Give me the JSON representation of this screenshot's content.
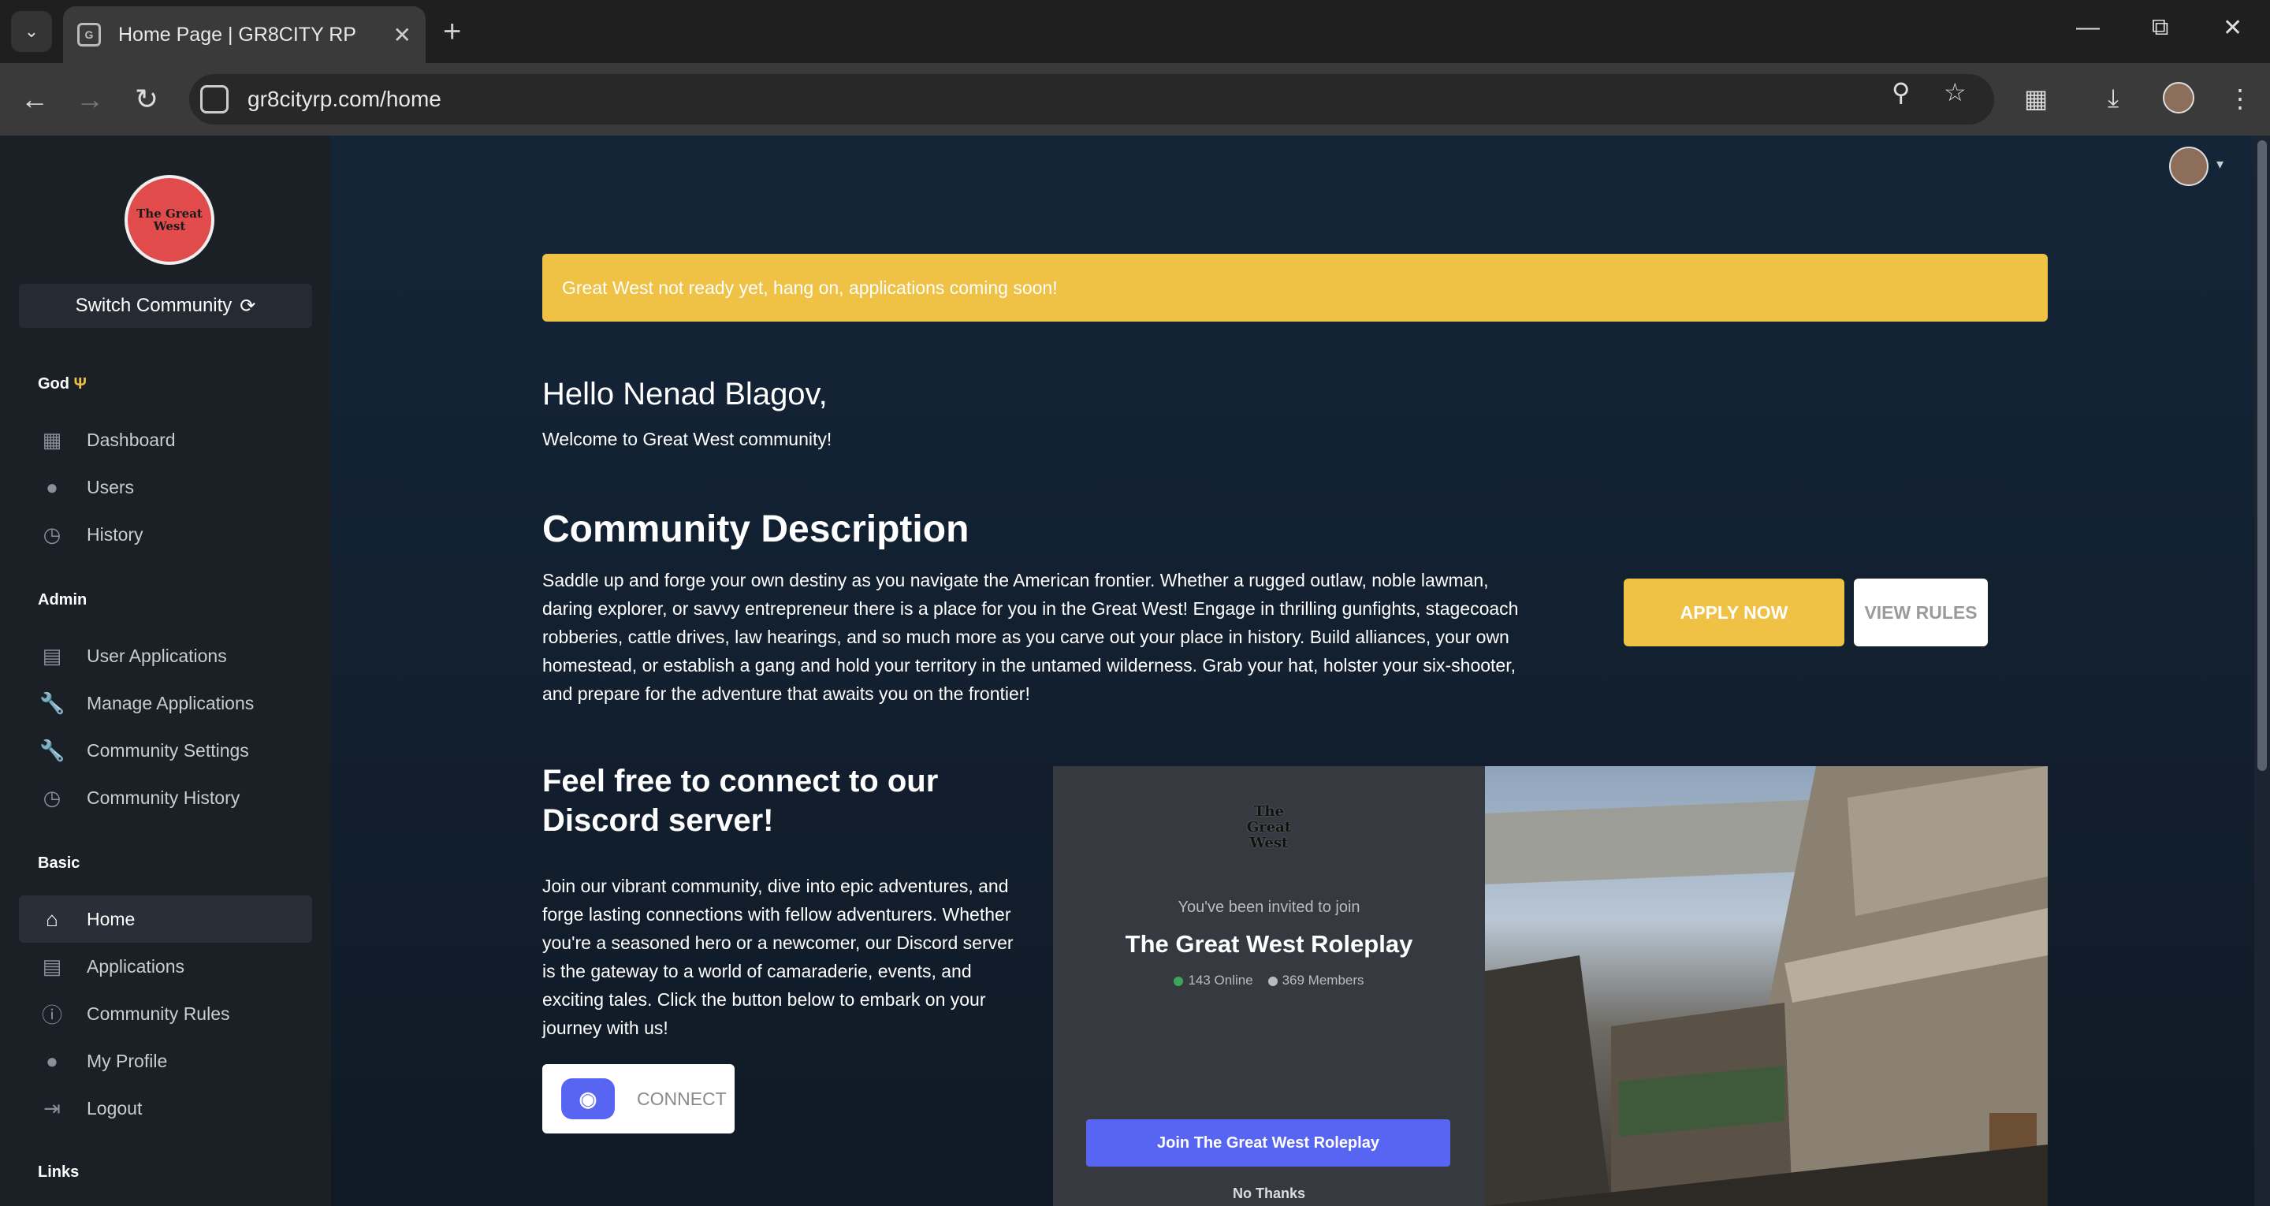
{
  "browser": {
    "tab_title": "Home Page | GR8CITY RP",
    "url": "gr8cityrp.com/home"
  },
  "sidebar": {
    "logo_text": "The Great West",
    "switch_label": "Switch Community",
    "sections": {
      "god": "God",
      "admin": "Admin",
      "basic": "Basic",
      "links": "Links"
    },
    "god_items": [
      {
        "label": "Dashboard",
        "icon": "dashboard-icon"
      },
      {
        "label": "Users",
        "icon": "user-icon"
      },
      {
        "label": "History",
        "icon": "history-icon"
      }
    ],
    "admin_items": [
      {
        "label": "User Applications",
        "icon": "server-icon"
      },
      {
        "label": "Manage Applications",
        "icon": "wrench-icon"
      },
      {
        "label": "Community Settings",
        "icon": "wrench-icon"
      },
      {
        "label": "Community History",
        "icon": "history-icon"
      }
    ],
    "basic_items": [
      {
        "label": "Home",
        "icon": "home-icon",
        "active": true
      },
      {
        "label": "Applications",
        "icon": "server-icon"
      },
      {
        "label": "Community Rules",
        "icon": "exclamation-icon"
      },
      {
        "label": "My Profile",
        "icon": "user-icon"
      },
      {
        "label": "Logout",
        "icon": "logout-icon"
      }
    ]
  },
  "main": {
    "alert": "Great West not ready yet, hang on, applications coming soon!",
    "hello": "Hello Nenad Blagov,",
    "welcome": "Welcome to Great West community!",
    "desc_title": "Community Description",
    "desc_text": "Saddle up and forge your own destiny as you navigate the American frontier. Whether a rugged outlaw, noble lawman, daring explorer, or savvy entrepreneur there is a place for you in the Great West! Engage in thrilling gunfights, stagecoach robberies, cattle drives, law hearings, and so much more as you carve out your place in history. Build alliances, your own homestead, or establish a gang and hold your territory in the untamed wilderness. Grab your hat, holster your six-shooter, and prepare for the adventure that awaits you on the frontier!",
    "apply_label": "APPLY NOW",
    "rules_label": "VIEW RULES",
    "discord_title": "Feel free to connect to our Discord server!",
    "discord_text": "Join our vibrant community, dive into epic adventures, and forge lasting connections with fellow adventurers. Whether you're a seasoned hero or a newcomer, our Discord server is the gateway to a world of camaraderie, events, and exciting tales. Click the button below to embark on your journey with us!",
    "connect_label": "CONNECT"
  },
  "invite": {
    "sub": "You've been invited to join",
    "name": "The Great West Roleplay",
    "online": "143 Online",
    "members": "369 Members",
    "join_label": "Join The Great West Roleplay",
    "no_label": "No Thanks"
  },
  "colors": {
    "accent": "#efc144",
    "discord": "#5865f2",
    "online": "#3ba55c",
    "members": "#b9bbbe"
  }
}
